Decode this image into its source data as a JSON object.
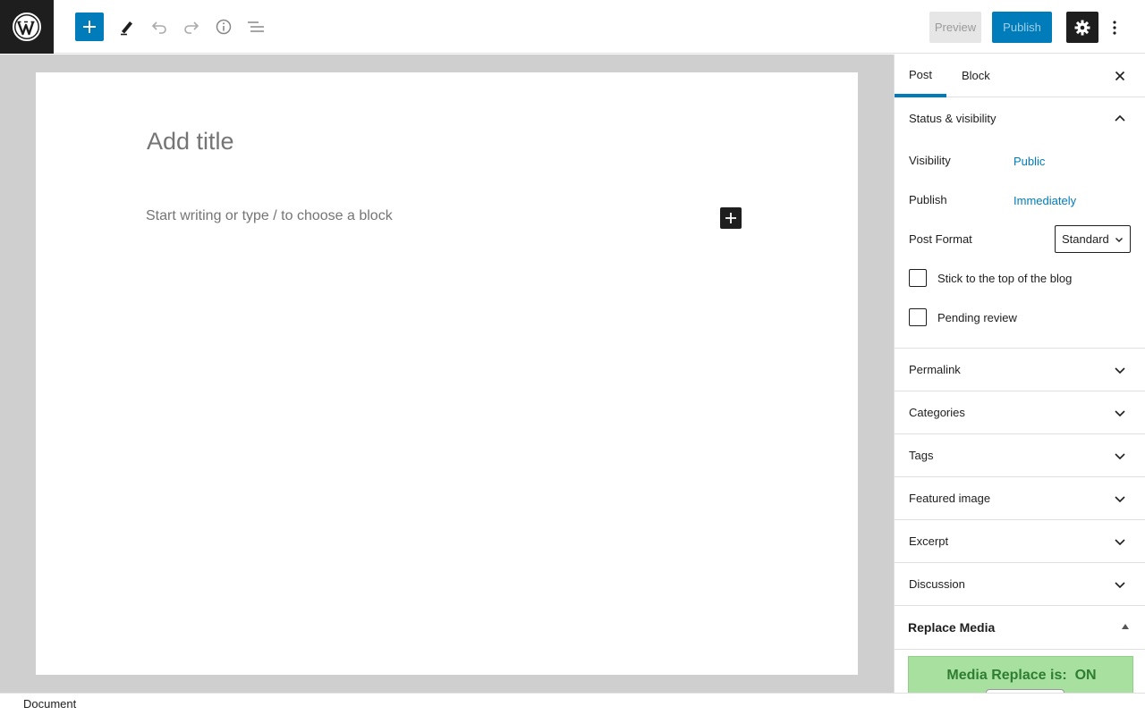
{
  "toolbar": {
    "logo_icon": "wordpress-logo-icon",
    "add_block_icon": "plus-icon",
    "tools_icon": "pencil-icon",
    "undo_icon": "undo-icon",
    "redo_icon": "redo-icon",
    "details_icon": "info-icon",
    "list_view_icon": "list-view-icon",
    "preview_label": "Preview",
    "publish_label": "Publish",
    "settings_icon": "gear-icon",
    "more_icon": "vertical-ellipsis-icon"
  },
  "editor": {
    "title_placeholder": "Add title",
    "block_placeholder": "Start writing or type / to choose a block",
    "inline_add_icon": "plus-icon"
  },
  "sidebar": {
    "tabs": [
      {
        "label": "Post",
        "active": true
      },
      {
        "label": "Block",
        "active": false
      }
    ],
    "close_icon": "close-icon",
    "status_panel": {
      "title": "Status & visibility",
      "visibility_label": "Visibility",
      "visibility_value": "Public",
      "publish_label": "Publish",
      "publish_value": "Immediately",
      "format_label": "Post Format",
      "format_value": "Standard",
      "sticky_label": "Stick to the top of the blog",
      "pending_label": "Pending review"
    },
    "panels": [
      {
        "title": "Permalink"
      },
      {
        "title": "Categories"
      },
      {
        "title": "Tags"
      },
      {
        "title": "Featured image"
      },
      {
        "title": "Excerpt"
      },
      {
        "title": "Discussion"
      }
    ],
    "replace_media": {
      "title": "Replace Media",
      "banner": "Media Replace is:  ON"
    }
  },
  "footer": {
    "breadcrumb": "Document"
  },
  "colors": {
    "accent": "#007cba",
    "dark": "#1e1e1e",
    "banner_bg": "#a8e0a0",
    "banner_text": "#2e7d32"
  }
}
